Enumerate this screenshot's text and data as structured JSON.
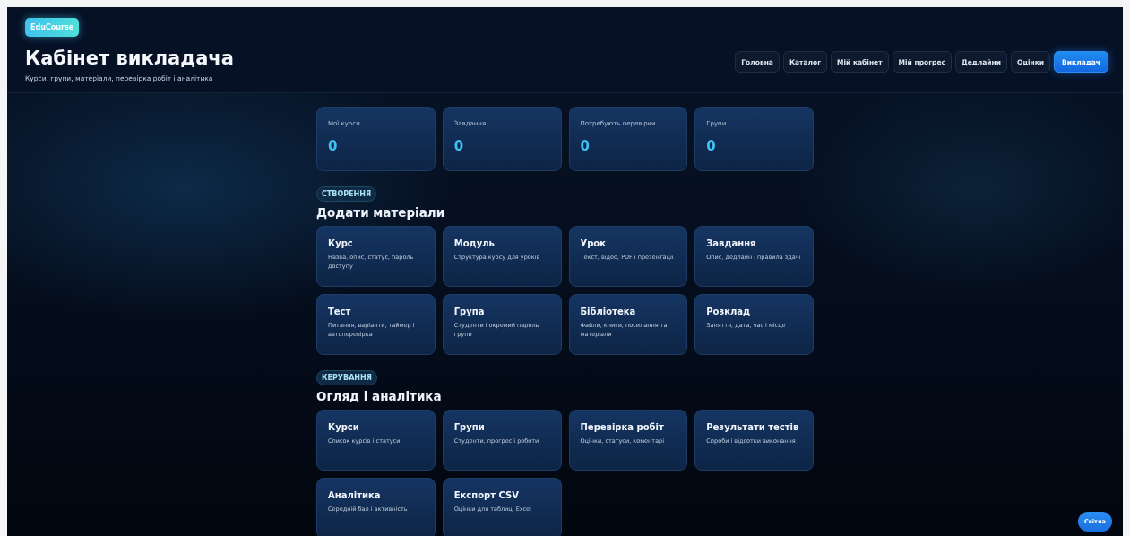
{
  "header": {
    "brand": "EduCourse",
    "title": "Кабінет викладача",
    "subtitle": "Курси, групи, матеріали, перевірка робіт і аналітика"
  },
  "nav": [
    {
      "label": "Головна",
      "selected": false
    },
    {
      "label": "Каталог",
      "selected": false
    },
    {
      "label": "Мій кабінет",
      "selected": false
    },
    {
      "label": "Мій прогрес",
      "selected": false
    },
    {
      "label": "Дедлайни",
      "selected": false
    },
    {
      "label": "Оцінки",
      "selected": false
    },
    {
      "label": "Викладач",
      "selected": true
    }
  ],
  "stats": [
    {
      "label": "Мої курси",
      "value": "0"
    },
    {
      "label": "Завдання",
      "value": "0"
    },
    {
      "label": "Потребують перевірки",
      "value": "0"
    },
    {
      "label": "Групи",
      "value": "0"
    }
  ],
  "sections": [
    {
      "chip": "СТВОРЕННЯ",
      "heading": "Додати матеріали",
      "cards": [
        {
          "title": "Курс",
          "description": "Назва, опис, статус, пароль доступу"
        },
        {
          "title": "Модуль",
          "description": "Структура курсу для уроків"
        },
        {
          "title": "Урок",
          "description": "Текст, відео, PDF і презентації"
        },
        {
          "title": "Завдання",
          "description": "Опис, дедлайн і правила здачі"
        },
        {
          "title": "Тест",
          "description": "Питання, варіанти, таймер і автоперевірка"
        },
        {
          "title": "Група",
          "description": "Студенти і окремий пароль групи"
        },
        {
          "title": "Бібліотека",
          "description": "Файли, книги, посилання та матеріали"
        },
        {
          "title": "Розклад",
          "description": "Заняття, дата, час і місце"
        }
      ]
    },
    {
      "chip": "КЕРУВАННЯ",
      "heading": "Огляд і аналітика",
      "cards": [
        {
          "title": "Курси",
          "description": "Список курсів і статуси"
        },
        {
          "title": "Групи",
          "description": "Студенти, прогрес і роботи"
        },
        {
          "title": "Перевірка робіт",
          "description": "Оцінки, статуси, коментарі"
        },
        {
          "title": "Результати тестів",
          "description": "Спроби і відсотки виконання"
        },
        {
          "title": "Аналітика",
          "description": "Середній бал і активність"
        },
        {
          "title": "Експорт CSV",
          "description": "Оцінки для таблиці Excel"
        }
      ]
    }
  ],
  "theme_button": "Світла"
}
